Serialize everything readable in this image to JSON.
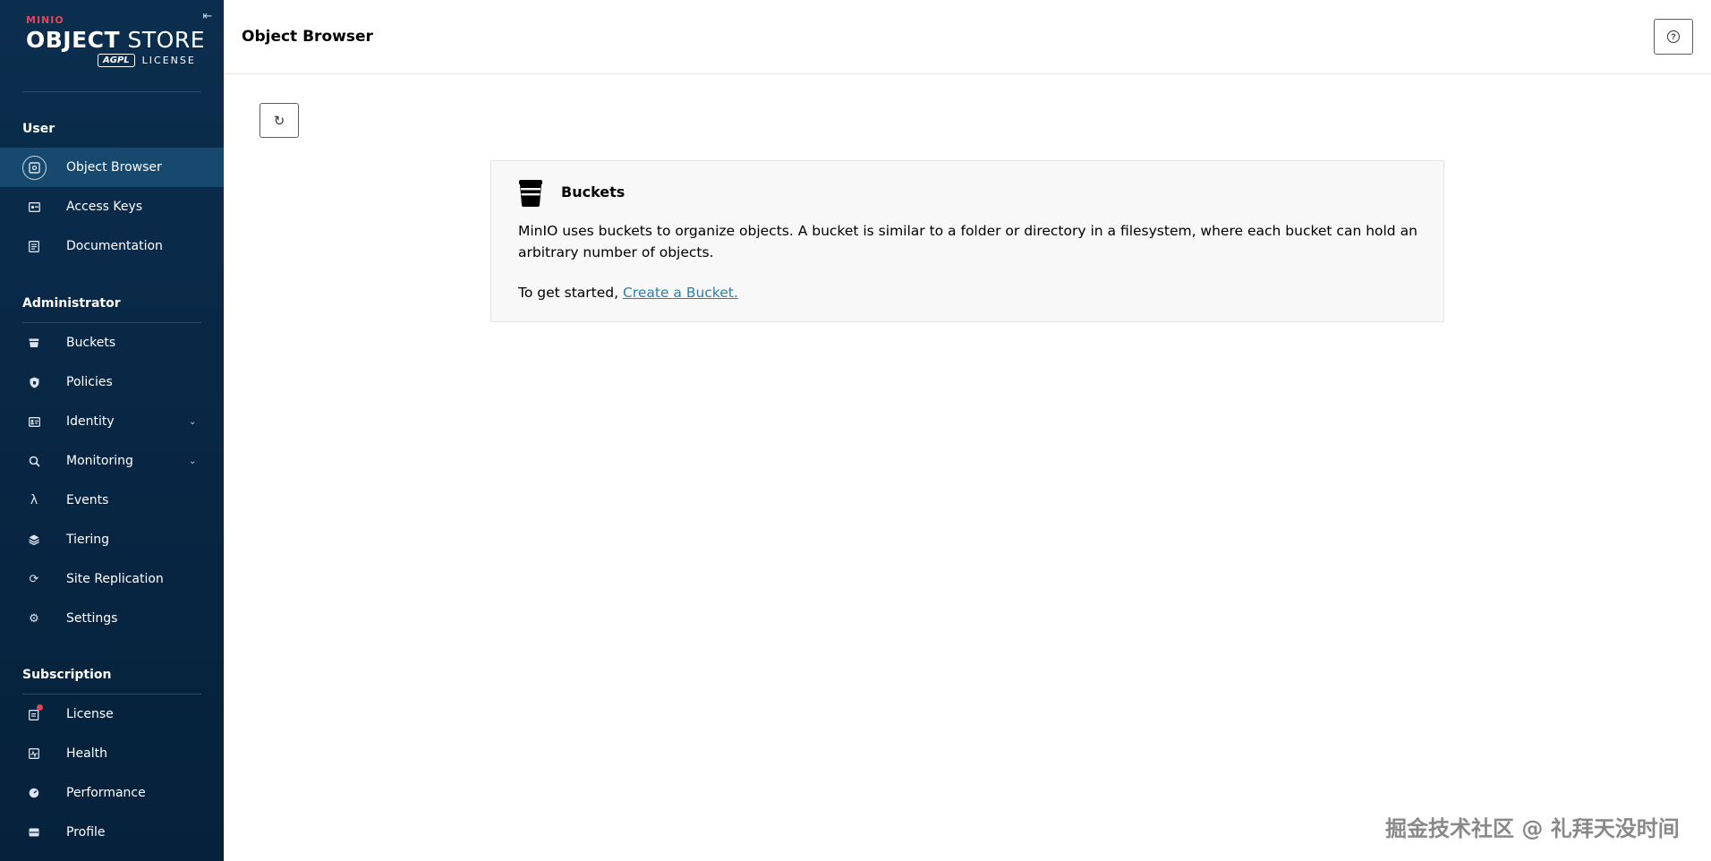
{
  "logo": {
    "brand": "MINIO",
    "product_bold": "OBJECT",
    "product_thin": " STORE",
    "agpl": "AGPL",
    "license": "LICENSE"
  },
  "sidebar": {
    "collapse_icon": "collapse-icon",
    "sections": [
      {
        "title": "User"
      },
      {
        "title": "Administrator"
      },
      {
        "title": "Subscription"
      }
    ],
    "items": [
      {
        "label": "Object Browser",
        "icon": "object-browser-icon",
        "active": true
      },
      {
        "label": "Access Keys",
        "icon": "key-icon"
      },
      {
        "label": "Documentation",
        "icon": "document-icon"
      },
      {
        "label": "Buckets",
        "icon": "bucket-icon"
      },
      {
        "label": "Policies",
        "icon": "shield-icon"
      },
      {
        "label": "Identity",
        "icon": "identity-icon",
        "expandable": true
      },
      {
        "label": "Monitoring",
        "icon": "search-icon",
        "expandable": true
      },
      {
        "label": "Events",
        "icon": "lambda-icon"
      },
      {
        "label": "Tiering",
        "icon": "layers-icon"
      },
      {
        "label": "Site Replication",
        "icon": "sync-icon"
      },
      {
        "label": "Settings",
        "icon": "gear-icon"
      },
      {
        "label": "License",
        "icon": "license-icon",
        "badge": true
      },
      {
        "label": "Health",
        "icon": "health-icon"
      },
      {
        "label": "Performance",
        "icon": "gauge-icon"
      },
      {
        "label": "Profile",
        "icon": "profile-icon"
      }
    ]
  },
  "header": {
    "title": "Object Browser",
    "help_icon": "help-icon"
  },
  "main": {
    "refresh_icon": "refresh-icon",
    "card": {
      "title": "Buckets",
      "description": "MinIO uses buckets to organize objects. A bucket is similar to a folder or directory in a filesystem, where each bucket can hold an arbitrary number of objects.",
      "cta_prefix": "To get started, ",
      "cta_link": "Create a Bucket."
    }
  },
  "watermark": "掘金技术社区 @ 礼拜天没时间",
  "colors": {
    "sidebar_bg": "#082846",
    "sidebar_active": "#17486d",
    "brand_red": "#e0455a",
    "link": "#2781b0"
  }
}
